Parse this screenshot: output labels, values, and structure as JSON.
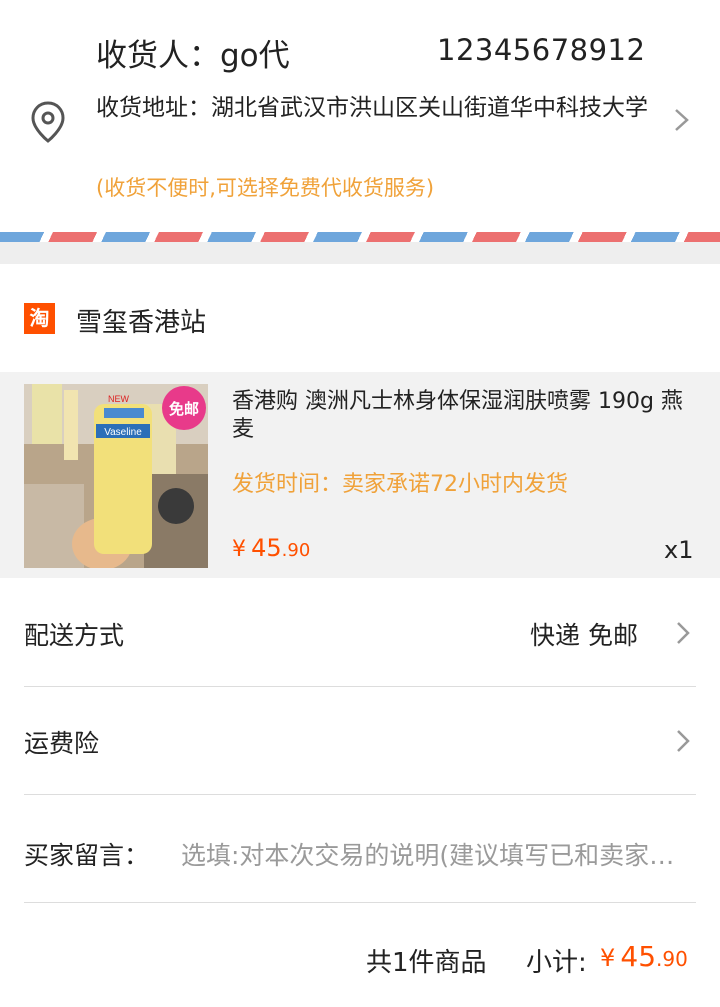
{
  "address": {
    "recipient": "收货人：go代",
    "phone": "12345678912",
    "address_line": "收货地址：湖北省武汉市洪山区关山街道华中科技大学",
    "note": "(收货不便时,可选择免费代收货服务)"
  },
  "shop": {
    "logo_char": "淘",
    "name": "雪玺香港站"
  },
  "product": {
    "title": "香港购 澳洲凡士林身体保湿润肤喷雾 190g 燕麦",
    "shipping": "发货时间：卖家承诺72小时内发货",
    "price_currency": "¥",
    "price_int": "45",
    "price_dec": ".90",
    "quantity": "x1",
    "image": {
      "brand_text": "Vaseline",
      "badge_text": "免邮",
      "new_text": "NEW"
    }
  },
  "delivery": {
    "label": "配送方式",
    "value": "快递 免邮"
  },
  "insurance": {
    "label": "运费险"
  },
  "message": {
    "label": "买家留言：",
    "placeholder": "选填:对本次交易的说明(建议填写已和卖家协商一致的内容)"
  },
  "footer": {
    "count": "共1件商品",
    "subtotal_label": "小计:",
    "price_currency": "¥",
    "price_int": "45",
    "price_dec": ".90"
  },
  "colors": {
    "accent": "#ff5000",
    "note": "#f0a23a"
  }
}
